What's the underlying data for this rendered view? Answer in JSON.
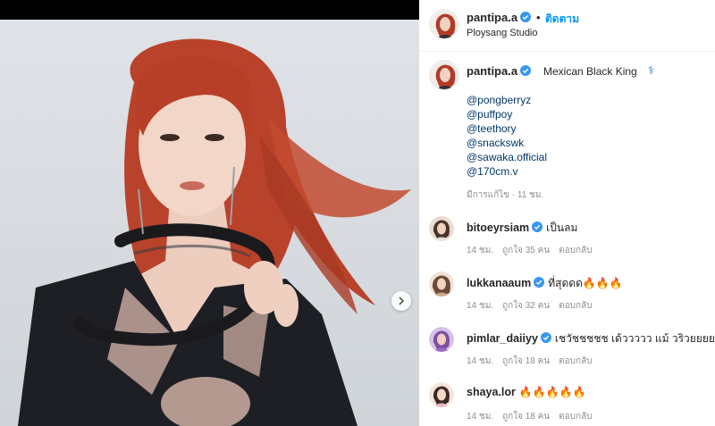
{
  "post": {
    "username": "pantipa.a",
    "follow_dot": "•",
    "follow_label": "ติดตาม",
    "location": "Ploysang Studio"
  },
  "caption": {
    "username": "pantipa.a",
    "text": "Mexican Black King",
    "emoji": "⚕",
    "mentions": [
      "@pongberryz",
      "@puffpoy",
      "@teethory",
      "@snackswk",
      "@sawaka.official",
      "@170cm.v"
    ],
    "edited": "มีการแก้ไข · 11 ชม."
  },
  "comments": [
    {
      "username": "bitoeyrsiam",
      "verified": true,
      "text": "เป็นลม",
      "time": "14 ชม.",
      "likes": "ถูกใจ 35 คน",
      "reply": "ตอบกลับ"
    },
    {
      "username": "lukkanaaum",
      "verified": true,
      "text": "ที่สุดดด🔥🔥🔥",
      "time": "14 ชม.",
      "likes": "ถูกใจ 32 คน",
      "reply": "ตอบกลับ"
    },
    {
      "username": "pimlar_daiiyy",
      "verified": true,
      "text": "เชวัชชชชช เด้ววววว แม้ วริวยยยยยย",
      "time": "14 ชม.",
      "likes": "ถูกใจ 18 คน",
      "reply": "ตอบกลับ"
    },
    {
      "username": "shaya.lor",
      "verified": false,
      "text": "🔥🔥🔥🔥🔥",
      "time": "14 ชม.",
      "likes": "ถูกใจ 18 คน",
      "reply": "ตอบกลับ"
    }
  ],
  "colors": {
    "link": "#00376b",
    "follow": "#0095f6",
    "verified": "#3897f0",
    "muted": "#8e8e8e"
  },
  "icons": {
    "verified": "verified-badge-icon",
    "next": "chevron-right-icon"
  }
}
